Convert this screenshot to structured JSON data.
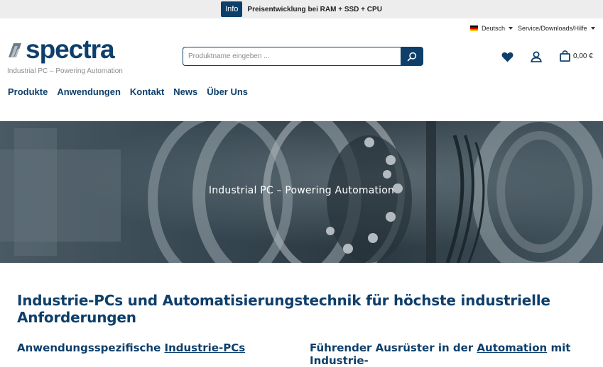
{
  "topbar": {
    "badge": "Info",
    "message": "Preisentwicklung bei RAM + SSD + CPU"
  },
  "header": {
    "language": "Deutsch",
    "service": "Service/Downloads/Hilfe",
    "logo_text": "spectra",
    "tagline": "Industrial PC – Powering Automation",
    "search_placeholder": "Produktname eingeben ...",
    "cart_amount": "0,00 €",
    "icons": {
      "wishlist": "heart-icon",
      "account": "user-icon",
      "cart": "shopping-bag-icon",
      "search": "search-icon"
    }
  },
  "nav": {
    "items": [
      "Produkte",
      "Anwendungen",
      "Kontakt",
      "News",
      "Über Uns"
    ]
  },
  "hero": {
    "title": "Industrial PC – Powering Automation"
  },
  "content": {
    "heading": "Industrie-PCs und Automatisierungstechnik für höchste industrielle Anforderungen",
    "left": {
      "prefix": "Anwendungsspezifische ",
      "link": "Industrie-PCs"
    },
    "right": {
      "prefix": "Führender Ausrüster in der ",
      "link": "Automation",
      "suffix": " mit Industrie-"
    }
  },
  "colors": {
    "brand": "#0e3f6b",
    "topbar_bg": "#ededed"
  }
}
